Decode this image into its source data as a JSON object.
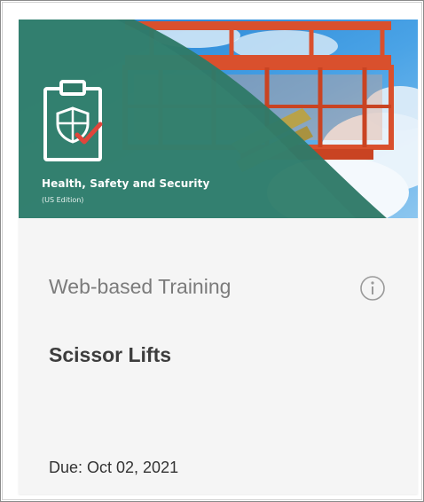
{
  "card": {
    "badge_title": "Health, Safety and Security",
    "badge_subtitle": "(US Edition)",
    "training_type": "Web-based Training",
    "course_title": "Scissor Lifts",
    "due_label": "Due: Oct 02, 2021",
    "info_icon": "info-circle-icon",
    "badge_icon": "clipboard-shield-check-icon"
  },
  "colors": {
    "teal_overlay": "#2f7a68",
    "card_background": "#f5f5f5",
    "lift_red": "#d9502d",
    "sky_blue": "#2f8fd8",
    "check_red": "#e0453b"
  }
}
